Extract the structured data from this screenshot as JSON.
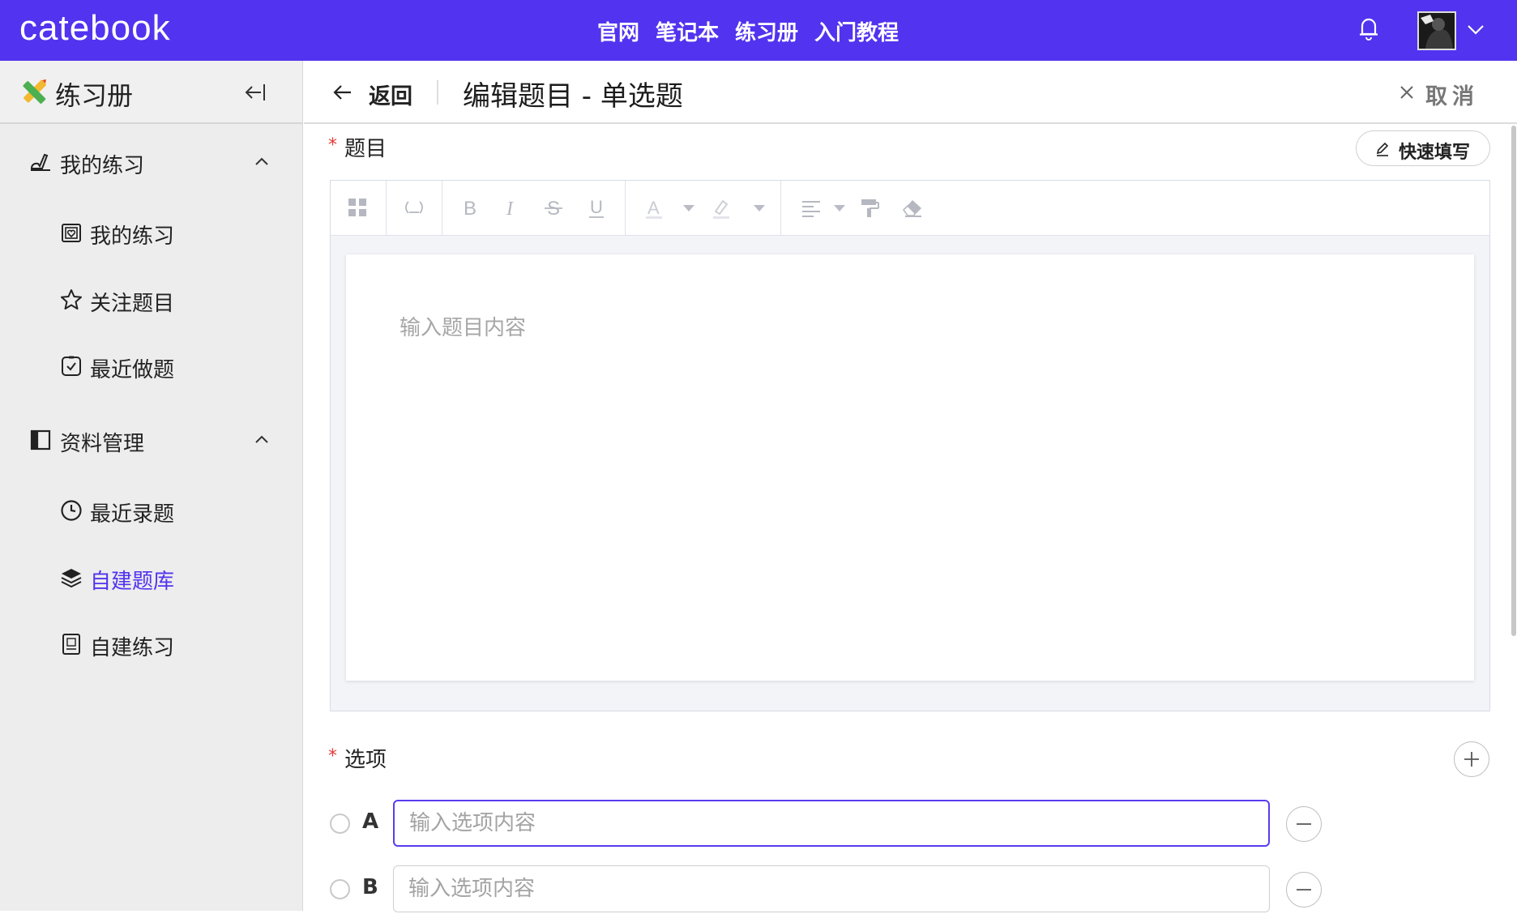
{
  "topbar": {
    "brand": "catebook",
    "nav": [
      "官网",
      "笔记本",
      "练习册",
      "入门教程"
    ],
    "colors": {
      "accent": "#5233ef"
    }
  },
  "sidebar": {
    "title": "练习册",
    "groups": [
      {
        "label": "我的练习",
        "icon": "hand-pen-icon",
        "expanded": true,
        "items": [
          {
            "label": "我的练习",
            "icon": "heart-clipboard-icon"
          },
          {
            "label": "关注题目",
            "icon": "star-icon"
          },
          {
            "label": "最近做题",
            "icon": "check-square-icon"
          }
        ]
      },
      {
        "label": "资料管理",
        "icon": "book-icon",
        "expanded": true,
        "items": [
          {
            "label": "最近录题",
            "icon": "clock-icon"
          },
          {
            "label": "自建题库",
            "icon": "layers-icon",
            "active": true
          },
          {
            "label": "自建练习",
            "icon": "practice-doc-icon"
          }
        ]
      }
    ]
  },
  "header": {
    "back_label": "返回",
    "title": "编辑题目 - 单选题",
    "cancel_label": "取消"
  },
  "question": {
    "label": "题目",
    "quick_fill_label": "快速填写",
    "placeholder": "输入题目内容"
  },
  "options": {
    "label": "选项",
    "items": [
      {
        "letter": "A",
        "placeholder": "输入选项内容",
        "value": "",
        "focused": true
      },
      {
        "letter": "B",
        "placeholder": "输入选项内容",
        "value": "",
        "focused": false
      }
    ]
  }
}
